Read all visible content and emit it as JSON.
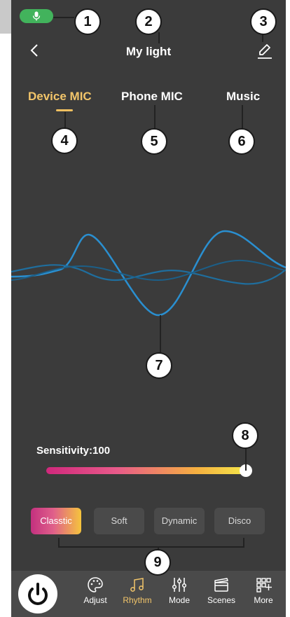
{
  "header": {
    "title": "My light",
    "back_icon": "chevron-left-icon",
    "edit_icon": "pencil-icon",
    "mic_indicator_icon": "microphone-icon",
    "mic_indicator_color": "#42b35c"
  },
  "source_tabs": [
    {
      "label": "Device MIC",
      "active": true
    },
    {
      "label": "Phone MIC",
      "active": false
    },
    {
      "label": "Music",
      "active": false
    }
  ],
  "sensitivity": {
    "label": "Sensitivity:100",
    "value": 100
  },
  "effects": [
    {
      "label": "Classtic",
      "active": true
    },
    {
      "label": "Soft",
      "active": false
    },
    {
      "label": "Dynamic",
      "active": false
    },
    {
      "label": "Disco",
      "active": false
    }
  ],
  "nav": {
    "power_icon": "power-icon",
    "items": [
      {
        "label": "Adjust",
        "icon": "palette-icon"
      },
      {
        "label": "Rhythm",
        "icon": "music-note-icon",
        "active": true
      },
      {
        "label": "Mode",
        "icon": "sliders-icon"
      },
      {
        "label": "Scenes",
        "icon": "clapperboard-icon"
      },
      {
        "label": "More",
        "icon": "grid-plus-icon"
      }
    ]
  },
  "callouts": [
    "1",
    "2",
    "3",
    "4",
    "5",
    "6",
    "7",
    "8",
    "9"
  ],
  "colors": {
    "background": "#3b3b3b",
    "accent": "#f2c56a",
    "wave": "#2a8fd0"
  }
}
